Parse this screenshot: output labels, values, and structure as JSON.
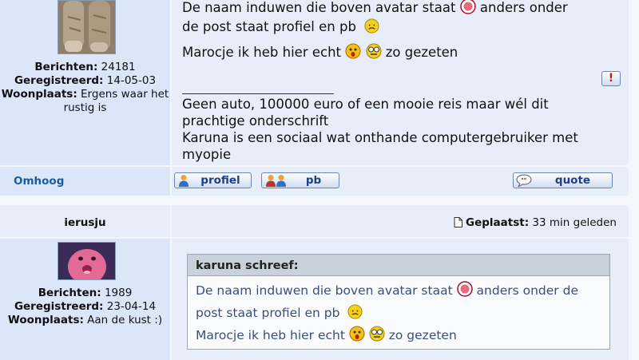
{
  "post1": {
    "author_stats": {
      "posts_label": "Berichten:",
      "posts_value": "24181",
      "registered_label": "Geregistreerd:",
      "registered_value": "14-05-03",
      "location_label": "Woonplaats:",
      "location_value": "Ergens waar het rustig is"
    },
    "body": {
      "line1a": "De naam induwen die boven avatar staat",
      "line1b": "anders onder",
      "line2": "de post staat profiel en pb",
      "line3a": "Marocje ik heb hier echt",
      "line3b": "zo gezeten"
    },
    "signature": {
      "line1": "Geen auto, 100000 euro of een mooie reis maar wél dit",
      "line2": "prachtige onderschrift",
      "line3": "Karuna is een sociaal wat onthande computergebruiker met",
      "line4": "myopie"
    },
    "footer": {
      "top_link": "Omhoog",
      "profile_btn": "profiel",
      "pm_btn": "pb",
      "quote_btn": "quote"
    }
  },
  "post2": {
    "author_name": "ierusju",
    "posted_label": "Geplaatst:",
    "posted_value": "33 min geleden",
    "author_stats": {
      "posts_label": "Berichten:",
      "posts_value": "1989",
      "registered_label": "Geregistreerd:",
      "registered_value": "23-04-14",
      "location_label": "Woonplaats:",
      "location_value": "Aan de kust :)"
    },
    "quote": {
      "header": "karuna schreef:",
      "line1a": "De naam induwen die boven avatar staat",
      "line1b": "anders onder de",
      "line2": "post staat profiel en pb",
      "line3a": "Marocje ik heb hier echt",
      "line3b": "zo gezeten"
    }
  },
  "icons": [
    "report-icon",
    "profile-icon",
    "pm-icon",
    "quote-icon",
    "post-document-icon",
    "smiley-icons"
  ]
}
